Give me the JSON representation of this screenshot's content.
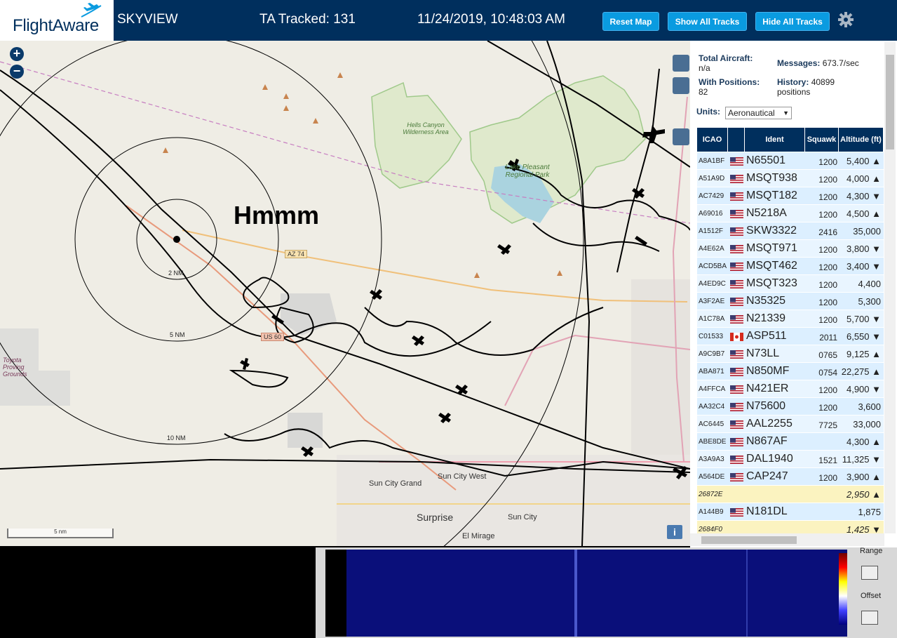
{
  "header": {
    "logo_text": "FlightAware",
    "title": "SKYVIEW",
    "tracked": "TA Tracked: 131",
    "datetime": "11/24/2019, 10:48:03 AM",
    "buttons": [
      "Reset Map",
      "Show All Tracks",
      "Hide All Tracks"
    ]
  },
  "map": {
    "annotation": "Hmmm",
    "range_labels": [
      "2 NM",
      "5 NM",
      "10 NM"
    ],
    "scale": "5 nm",
    "places": [
      "Hells Canyon Wilderness Area",
      "Lake Pleasant Regional Park",
      "Toyota Proving Grounds",
      "Sun City Grand",
      "Sun City West",
      "Surprise",
      "Sun City",
      "El Mirage",
      "AZ 74",
      "US 60"
    ]
  },
  "stats": {
    "total_label": "Total Aircraft:",
    "total_value": "n/a",
    "positions_label": "With Positions:",
    "positions_value": "82",
    "messages_label": "Messages:",
    "messages_value": "673.7/sec",
    "history_label": "History:",
    "history_value": "40899 positions",
    "units_label": "Units:",
    "units_value": "Aeronautical"
  },
  "table": {
    "headers": [
      "ICAO",
      "Ident",
      "Squawk",
      "Altitude (ft)"
    ],
    "rows": [
      {
        "icao": "A8A1BF",
        "flag": "us",
        "ident": "N65501",
        "squawk": "1200",
        "alt": "5,400 ▲"
      },
      {
        "icao": "A51A9D",
        "flag": "us",
        "ident": "MSQT938",
        "squawk": "1200",
        "alt": "4,000 ▲"
      },
      {
        "icao": "AC7429",
        "flag": "us",
        "ident": "MSQT182",
        "squawk": "1200",
        "alt": "4,300 ▼"
      },
      {
        "icao": "A69016",
        "flag": "us",
        "ident": "N5218A",
        "squawk": "1200",
        "alt": "4,500 ▲"
      },
      {
        "icao": "A1512F",
        "flag": "us",
        "ident": "SKW3322",
        "squawk": "2416",
        "alt": "35,000"
      },
      {
        "icao": "A4E62A",
        "flag": "us",
        "ident": "MSQT971",
        "squawk": "1200",
        "alt": "3,800 ▼"
      },
      {
        "icao": "ACD5BA",
        "flag": "us",
        "ident": "MSQT462",
        "squawk": "1200",
        "alt": "3,400 ▼"
      },
      {
        "icao": "A4ED9C",
        "flag": "us",
        "ident": "MSQT323",
        "squawk": "1200",
        "alt": "4,400"
      },
      {
        "icao": "A3F2AE",
        "flag": "us",
        "ident": "N35325",
        "squawk": "1200",
        "alt": "5,300"
      },
      {
        "icao": "A1C78A",
        "flag": "us",
        "ident": "N21339",
        "squawk": "1200",
        "alt": "5,700 ▼"
      },
      {
        "icao": "C01533",
        "flag": "ca",
        "ident": "ASP511",
        "squawk": "2011",
        "alt": "6,550 ▼"
      },
      {
        "icao": "A9C9B7",
        "flag": "us",
        "ident": "N73LL",
        "squawk": "0765",
        "alt": "9,125 ▲"
      },
      {
        "icao": "ABA871",
        "flag": "us",
        "ident": "N850MF",
        "squawk": "0754",
        "alt": "22,275 ▲"
      },
      {
        "icao": "A4FFCA",
        "flag": "us",
        "ident": "N421ER",
        "squawk": "1200",
        "alt": "4,900 ▼"
      },
      {
        "icao": "AA32C4",
        "flag": "us",
        "ident": "N75600",
        "squawk": "1200",
        "alt": "3,600"
      },
      {
        "icao": "AC6445",
        "flag": "us",
        "ident": "AAL2255",
        "squawk": "7725",
        "alt": "33,000"
      },
      {
        "icao": "ABE8DE",
        "flag": "us",
        "ident": "N867AF",
        "squawk": "",
        "alt": "4,300 ▲"
      },
      {
        "icao": "A3A9A3",
        "flag": "us",
        "ident": "DAL1940",
        "squawk": "1521",
        "alt": "11,325 ▼"
      },
      {
        "icao": "A564DE",
        "flag": "us",
        "ident": "CAP247",
        "squawk": "1200",
        "alt": "3,900 ▲"
      },
      {
        "icao": "26872E",
        "flag": "",
        "ident": "",
        "squawk": "",
        "alt": "2,950 ▲"
      },
      {
        "icao": "A144B9",
        "flag": "us",
        "ident": "N181DL",
        "squawk": "",
        "alt": "1,875"
      },
      {
        "icao": "2684F0",
        "flag": "",
        "ident": "",
        "squawk": "",
        "alt": "1,425 ▼"
      }
    ]
  },
  "bottom": {
    "range_label": "Range",
    "offset_label": "Offset"
  },
  "colors": {
    "header_bg": "#002f5d",
    "button_bg": "#0a9be0",
    "row_blue": "#dcefff",
    "row_yellow": "#fbf3c0"
  }
}
